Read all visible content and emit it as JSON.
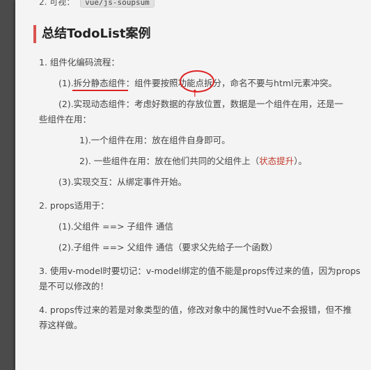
{
  "top_fragment": {
    "label": "2. 可视：",
    "code": "vue/js-soupsum"
  },
  "title": "总结TodoList案例",
  "items": [
    {
      "text": "1. 组件化编码流程："
    },
    {
      "text": "(1).拆分静态组件：组件要按照功能点拆分，命名不要与html元素冲突。"
    },
    {
      "text": "(2).实现动态组件：考虑好数据的存放位置，数据是一个组件在用，还是一"
    },
    {
      "text": "些组件在用："
    },
    {
      "text": "1).一个组件在用：放在组件自身即可。"
    },
    {
      "pre": "2). 一些组件在用：放在他们共同的父组件上（",
      "highlight": "状态提升",
      "post": "）。"
    },
    {
      "text": "(3).实现交互：从绑定事件开始。"
    },
    {
      "text": "2. props适用于："
    },
    {
      "text": "(1).父组件 ==> 子组件 通信"
    },
    {
      "text": "(2).子组件 ==> 父组件 通信（要求父先给子一个函数）"
    },
    {
      "text": "3. 使用v-model时要切记：v-model绑定的值不能是props传过来的值，因为props"
    },
    {
      "text": "是不可以修改的！"
    },
    {
      "text": "4. props传过来的若是对象类型的值，修改对象中的属性时Vue不会报错，但不推"
    },
    {
      "text": "荐这样做。"
    }
  ],
  "colors": {
    "accent": "#d9534f",
    "highlight": "#c0392b",
    "annotation": "#dd2222"
  }
}
